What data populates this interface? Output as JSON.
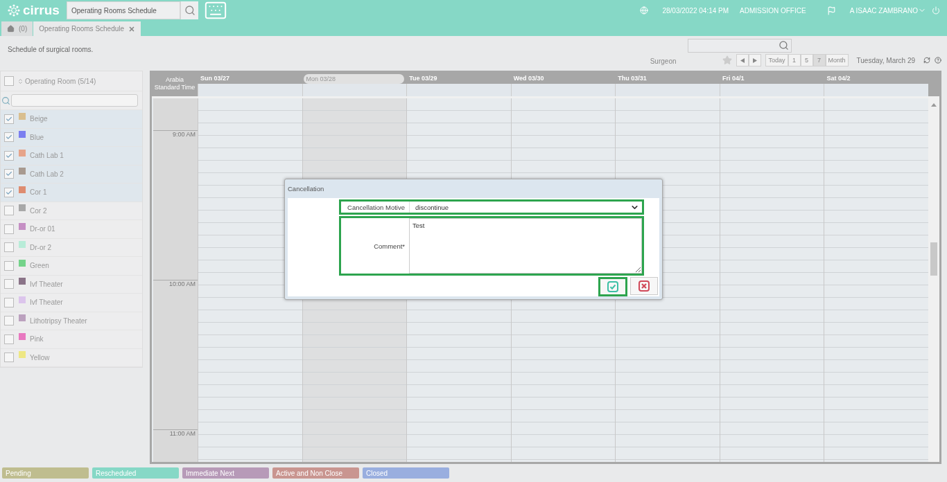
{
  "header": {
    "logo": "cirrus",
    "search": {
      "value": "Operating Rooms Schedule"
    },
    "datetime": "28/03/2022 04:14 PM",
    "office": "ADMISSION OFFICE",
    "user": "A ISAAC ZAMBRANO"
  },
  "tabs": [
    {
      "kind": "home",
      "label": "(0)",
      "selected": false
    },
    {
      "kind": "page",
      "label": "Operating Rooms Schedule",
      "selected": true
    }
  ],
  "description": "Schedule of surgical rooms.",
  "toolbar": {
    "filter_label": "Surgeon",
    "views": [
      {
        "label": "Today",
        "selected": false
      },
      {
        "label": "1",
        "selected": false
      },
      {
        "label": "5",
        "selected": false
      },
      {
        "label": "7",
        "selected": true
      },
      {
        "label": "Month",
        "selected": false
      }
    ],
    "date": "Tuesday, March 29"
  },
  "rooms": {
    "header": "Operating Room (5/14)",
    "checked_all": false,
    "items": [
      {
        "name": "Beige",
        "color": "#d9bf8f",
        "checked": true
      },
      {
        "name": "Blue",
        "color": "#7b7ff0",
        "checked": true
      },
      {
        "name": "Cath Lab 1",
        "color": "#e6a48a",
        "checked": true
      },
      {
        "name": "Cath Lab 2",
        "color": "#a89a90",
        "checked": true
      },
      {
        "name": "Cor 1",
        "color": "#de8c70",
        "checked": true
      },
      {
        "name": "Cor 2",
        "color": "#a8a8a8",
        "checked": false
      },
      {
        "name": "Dr-or 01",
        "color": "#c58fc4",
        "checked": false
      },
      {
        "name": "Dr-or 2",
        "color": "#b8ecd8",
        "checked": false
      },
      {
        "name": "Green",
        "color": "#74d38a",
        "checked": false
      },
      {
        "name": "Ivf Theater",
        "color": "#8a7388",
        "checked": false
      },
      {
        "name": "Ivf Theater",
        "color": "#dcc5ec",
        "checked": false
      },
      {
        "name": "Lithotripsy Theater",
        "color": "#bba1be",
        "checked": false
      },
      {
        "name": "Pink",
        "color": "#e879c0",
        "checked": false
      },
      {
        "name": "Yellow",
        "color": "#eee784",
        "checked": false
      }
    ]
  },
  "calendar": {
    "timezone": "Arabia Standard Time",
    "days": [
      {
        "label": "Sun 03/27",
        "selected": false
      },
      {
        "label": "Mon 03/28",
        "selected": true
      },
      {
        "label": "Tue 03/29",
        "selected": false
      },
      {
        "label": "Wed 03/30",
        "selected": false
      },
      {
        "label": "Thu 03/31",
        "selected": false
      },
      {
        "label": "Fri 04/1",
        "selected": false
      },
      {
        "label": "Sat 04/2",
        "selected": false
      }
    ],
    "times": [
      "9:00 AM",
      "10:00 AM",
      "11:00 AM"
    ]
  },
  "dialog": {
    "title": "Cancellation",
    "motive": {
      "label": "Cancellation Motive",
      "value": "discontinue"
    },
    "comment": {
      "label": "Comment*",
      "value": "Test"
    }
  },
  "legend": [
    {
      "label": "Pending",
      "color": "#bfbd8f"
    },
    {
      "label": "Rescheduled",
      "color": "#86d8c6"
    },
    {
      "label": "Immediate Next",
      "color": "#b79ab8"
    },
    {
      "label": "Active and Non Close",
      "color": "#c99590"
    },
    {
      "label": "Closed",
      "color": "#99aedf"
    }
  ]
}
